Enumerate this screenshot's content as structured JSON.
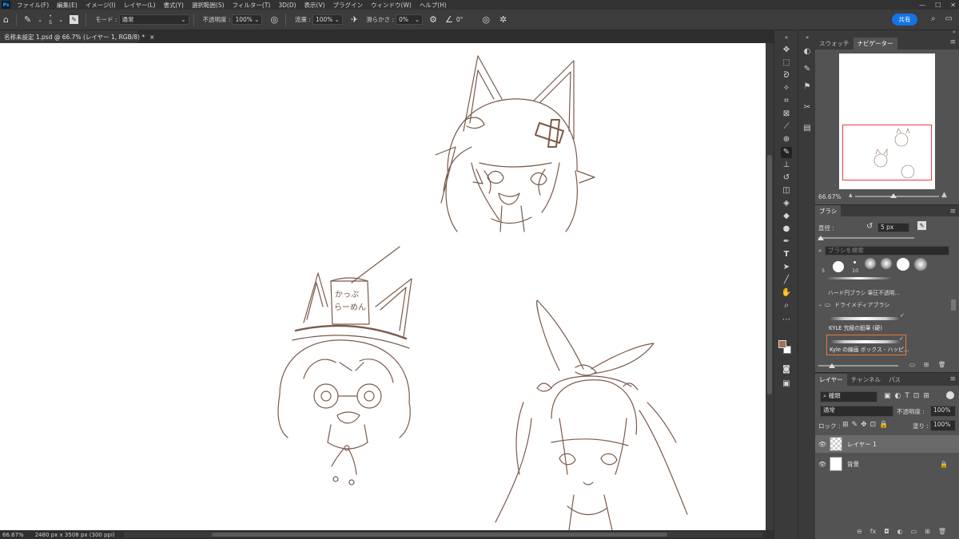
{
  "app": {
    "logo": "Ps"
  },
  "menu": [
    "ファイル(F)",
    "編集(E)",
    "イメージ(I)",
    "レイヤー(L)",
    "書式(Y)",
    "選択範囲(S)",
    "フィルター(T)",
    "3D(D)",
    "表示(V)",
    "プラグイン",
    "ウィンドウ(W)",
    "ヘルプ(H)"
  ],
  "window_controls": [
    "—",
    "☐",
    "✕"
  ],
  "options": {
    "brush_size": "5",
    "mode_label": "モード :",
    "mode_value": "通常",
    "opacity_label": "不透明度 :",
    "opacity_value": "100%",
    "flow_label": "流量 :",
    "flow_value": "100%",
    "smoothing_label": "滑らかさ :",
    "smoothing_value": "0%",
    "angle_value": "0°",
    "share_label": "共有"
  },
  "document": {
    "tab_title": "名称未設定 1.psd @ 66.7% (レイヤー 1, RGB/8) *",
    "zoom": "66.67%",
    "dimensions": "2480 px x 3508 px (300 ppi)"
  },
  "swatches": {
    "foreground": "#a07256",
    "background": "#ffffff"
  },
  "navigator": {
    "tabs": [
      "スウォッチ",
      "ナビゲーター"
    ],
    "zoom": "66.67%"
  },
  "brush_panel": {
    "title": "ブラシ",
    "size_label": "直径 :",
    "size_value": "5 px",
    "search_placeholder": "ブラシを検索",
    "tip_sizes": [
      "5",
      "10"
    ],
    "hard_brush_label": "ハード円ブラシ 筆圧不透明...",
    "group_name": "ドライメディアブラシ",
    "brush1": "KYLE 究極の鉛筆 (硬)",
    "brush2": "Kyle の線画 ボックス - ハッピ..."
  },
  "layers_panel": {
    "tabs": [
      "レイヤー",
      "チャンネル",
      "パス"
    ],
    "filter": "種類",
    "blend": "通常",
    "opacity_label": "不透明度 :",
    "opacity_value": "100%",
    "lock_label": "ロック :",
    "fill_label": "塗り :",
    "fill_value": "100%",
    "layers": [
      {
        "name": "レイヤー 1",
        "active": true
      },
      {
        "name": "背景",
        "active": false
      }
    ]
  },
  "canvas_text": {
    "hat_line1": "かっぷ",
    "hat_line2": "らーめん"
  },
  "ink_color": "#7a5a4a"
}
